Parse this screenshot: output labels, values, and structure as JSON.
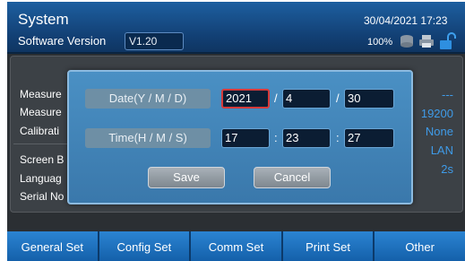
{
  "header": {
    "title": "System",
    "software_version_label": "Software Version",
    "software_version_value": "V1.20",
    "datetime": "30/04/2021 17:23",
    "battery": "100%",
    "icons": [
      "database-icon",
      "printer-icon",
      "lock-icon"
    ]
  },
  "left_items": [
    "Measure",
    "Measure",
    "Calibrati",
    "Screen B",
    "Languag",
    "Serial No"
  ],
  "right_values": [
    "---",
    "19200",
    "None",
    "LAN",
    "2s"
  ],
  "dialog": {
    "date_label": "Date(Y / M / D)",
    "time_label": "Time(H / M / S)",
    "year": "2021",
    "month": "4",
    "day": "30",
    "hour": "17",
    "minute": "23",
    "second": "27",
    "date_sep": "/",
    "time_sep": ":",
    "save": "Save",
    "cancel": "Cancel"
  },
  "tabs": [
    "General Set",
    "Config Set",
    "Comm Set",
    "Print Set",
    "Other"
  ]
}
